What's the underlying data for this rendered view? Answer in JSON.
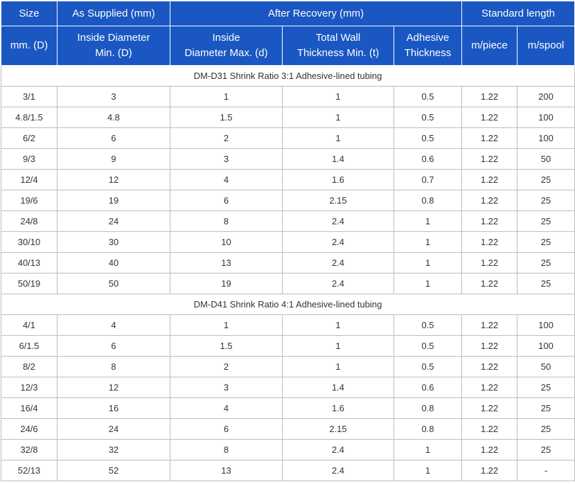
{
  "header": {
    "row1": {
      "size": "Size",
      "as_supplied": "As Supplied (mm)",
      "after_recovery": "After Recovery (mm)",
      "standard_length": "Standard length"
    },
    "row2": {
      "size_unit": "mm. (D)",
      "inside_diameter_min_l1": "Inside Diameter",
      "inside_diameter_min_l2": "Min. (D)",
      "inside_diameter_max_l1": "Inside",
      "inside_diameter_max_l2": "Diameter Max. (d)",
      "total_wall_l1": "Total Wall",
      "total_wall_l2": "Thickness Min. (t)",
      "adhesive_l1": "Adhesive",
      "adhesive_l2": "Thickness",
      "m_piece": "m/piece",
      "m_spool": "m/spool"
    }
  },
  "sections": [
    {
      "title": "DM-D31 Shrink Ratio 3:1 Adhesive-lined tubing",
      "rows": [
        [
          "3/1",
          "3",
          "1",
          "1",
          "0.5",
          "1.22",
          "200"
        ],
        [
          "4.8/1.5",
          "4.8",
          "1.5",
          "1",
          "0.5",
          "1.22",
          "100"
        ],
        [
          "6/2",
          "6",
          "2",
          "1",
          "0.5",
          "1.22",
          "100"
        ],
        [
          "9/3",
          "9",
          "3",
          "1.4",
          "0.6",
          "1.22",
          "50"
        ],
        [
          "12/4",
          "12",
          "4",
          "1.6",
          "0.7",
          "1.22",
          "25"
        ],
        [
          "19/6",
          "19",
          "6",
          "2.15",
          "0.8",
          "1.22",
          "25"
        ],
        [
          "24/8",
          "24",
          "8",
          "2.4",
          "1",
          "1.22",
          "25"
        ],
        [
          "30/10",
          "30",
          "10",
          "2.4",
          "1",
          "1.22",
          "25"
        ],
        [
          "40/13",
          "40",
          "13",
          "2.4",
          "1",
          "1.22",
          "25"
        ],
        [
          "50/19",
          "50",
          "19",
          "2.4",
          "1",
          "1.22",
          "25"
        ]
      ]
    },
    {
      "title": "DM-D41 Shrink Ratio 4:1 Adhesive-lined tubing",
      "rows": [
        [
          "4/1",
          "4",
          "1",
          "1",
          "0.5",
          "1.22",
          "100"
        ],
        [
          "6/1.5",
          "6",
          "1.5",
          "1",
          "0.5",
          "1.22",
          "100"
        ],
        [
          "8/2",
          "8",
          "2",
          "1",
          "0.5",
          "1.22",
          "50"
        ],
        [
          "12/3",
          "12",
          "3",
          "1.4",
          "0.6",
          "1.22",
          "25"
        ],
        [
          "16/4",
          "16",
          "4",
          "1.6",
          "0.8",
          "1.22",
          "25"
        ],
        [
          "24/6",
          "24",
          "6",
          "2.15",
          "0.8",
          "1.22",
          "25"
        ],
        [
          "32/8",
          "32",
          "8",
          "2.4",
          "1",
          "1.22",
          "25"
        ],
        [
          "52/13",
          "52",
          "13",
          "2.4",
          "1",
          "1.22",
          "-"
        ]
      ]
    }
  ]
}
